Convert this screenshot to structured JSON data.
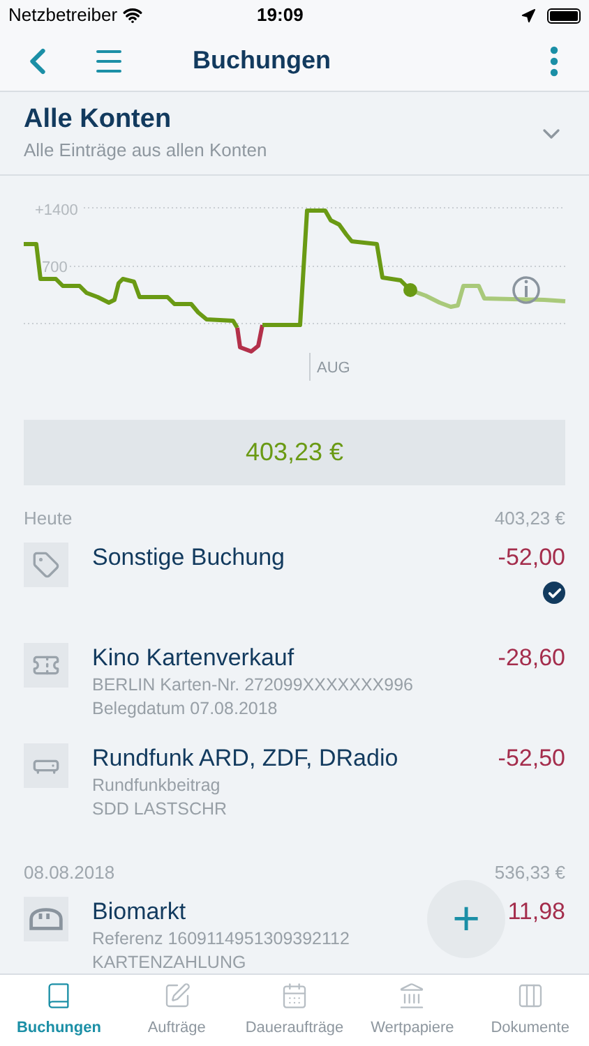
{
  "status_bar": {
    "carrier": "Netzbetreiber",
    "time": "19:09"
  },
  "nav": {
    "title": "Buchungen"
  },
  "account": {
    "title": "Alle Konten",
    "subtitle": "Alle Einträge aus allen Konten",
    "expanded": false
  },
  "chart": {
    "y_labels": [
      "+1400",
      "700"
    ],
    "month": "AUG"
  },
  "balance": "403,23 €",
  "groups": [
    {
      "date": "Heute",
      "total": "403,23 €",
      "entries": [
        {
          "title": "Sonstige Buchung",
          "amount": "-52,00",
          "checked": true
        },
        {
          "title": "Kino Kartenverkauf",
          "amount": "-28,60",
          "details": [
            "BERLIN Karten-Nr. 272099XXXXXXX996",
            "Belegdatum 07.08.2018"
          ],
          "checked": false
        },
        {
          "title": "Rundfunk ARD, ZDF, DRadio",
          "amount": "-52,50",
          "details": [
            "Rundfunkbeitrag",
            "SDD LASTSCHR"
          ],
          "checked": false
        }
      ]
    },
    {
      "date": "08.08.2018",
      "total": "536,33 €",
      "entries": [
        {
          "title": "Biomarkt",
          "amount": "11,98",
          "details": [
            "Referenz 1609114951309392112",
            "KARTENZAHLUNG"
          ],
          "checked": false
        }
      ]
    }
  ],
  "fab": {
    "label": "+"
  },
  "tabs": [
    {
      "label": "Buchungen",
      "selected": true
    },
    {
      "label": "Aufträge",
      "selected": false
    },
    {
      "label": "Daueraufträge",
      "selected": false
    },
    {
      "label": "Wertpapiere",
      "selected": false
    },
    {
      "label": "Dokumente",
      "selected": false
    }
  ]
}
